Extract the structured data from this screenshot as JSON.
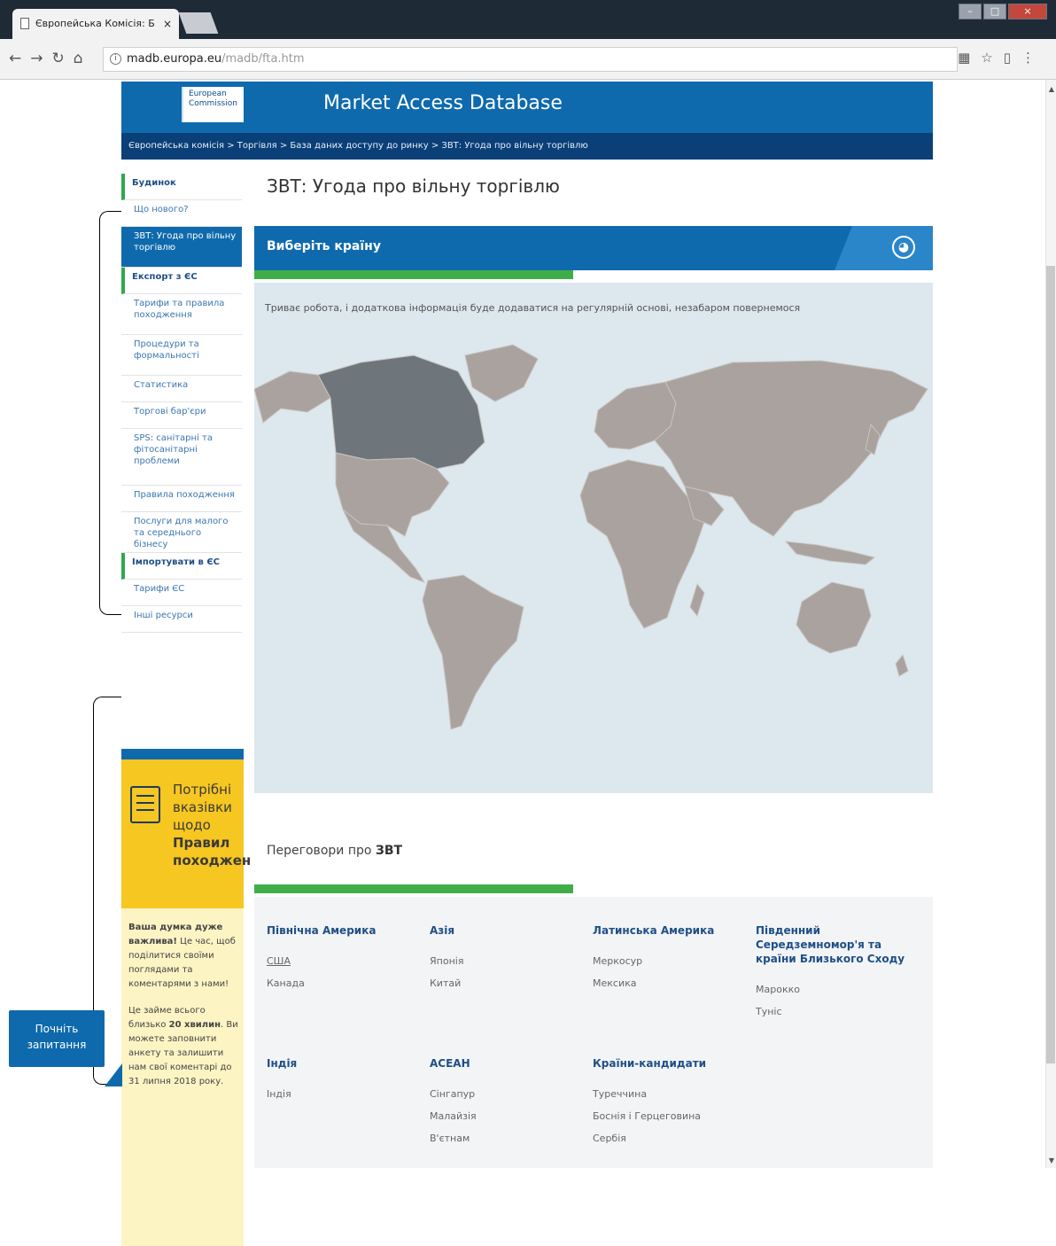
{
  "browser": {
    "tab_title": "Європейська Комісія: Б",
    "tab_close": "×",
    "url_host": "madb.europa.eu",
    "url_path": "/madb/fta.htm"
  },
  "header": {
    "logo_line1": "European",
    "logo_line2": "Commission",
    "site_title": "Market Access Database"
  },
  "breadcrumb": "Європейська комісія > Торгівля > База даних доступу до ринку > ЗВТ: Угода про вільну торгівлю",
  "sidebar": {
    "items": [
      {
        "label": "Будинок",
        "type": "section"
      },
      {
        "label": "Що нового?",
        "type": "link"
      },
      {
        "label": "ЗВТ: Угода про вільну торгівлю",
        "type": "active"
      },
      {
        "label": "Експорт з ЄС",
        "type": "section"
      },
      {
        "label": "Тарифи та правила походження",
        "type": "link"
      },
      {
        "label": "Процедури та формальності",
        "type": "link"
      },
      {
        "label": "Статистика",
        "type": "link"
      },
      {
        "label": "Торгові бар'єри",
        "type": "link"
      },
      {
        "label": "SPS: санітарні та фітосанітарні проблеми",
        "type": "link"
      },
      {
        "label": "Правила походження",
        "type": "link"
      },
      {
        "label": "Послуги для малого та середнього бізнесу",
        "type": "link"
      },
      {
        "label": "Імпортувати в ЄС",
        "type": "section"
      },
      {
        "label": "Тарифи ЄС",
        "type": "link"
      },
      {
        "label": "Інші ресурси",
        "type": "link"
      }
    ]
  },
  "promo": {
    "line1": "Потрібні",
    "line2": "вказівки",
    "line3": "щодо",
    "line4": "Правил",
    "line5": "походжен"
  },
  "feedback": {
    "bold": "Ваша думка дуже важлива!",
    "text1": " Це час, щоб поділитися своїми поглядами та коментарями з нами!",
    "text2": "Це займе всього близько ",
    "bold2": "20 хвилин",
    "text3": ". Ви можете заповнити анкету та залишити нам свої коментарі до 31 липня 2018 року.",
    "button": "Почніть запитання"
  },
  "main": {
    "page_title": "ЗВТ: Угода про вільну торгівлю",
    "select_country": "Виберіть країну",
    "note": "Триває робота, і додаткова інформація буде додаватися на регулярній основі, незабаром повернемося",
    "negotiations_prefix": "Переговори про ",
    "negotiations_bold": "ЗВТ"
  },
  "regions": [
    {
      "title": "Північна Америка",
      "items": [
        "США",
        "Канада"
      ]
    },
    {
      "title": "Азія",
      "items": [
        "Японія",
        "Китай"
      ]
    },
    {
      "title": "Латинська Америка",
      "items": [
        "Меркосур",
        "Мексика"
      ]
    },
    {
      "title": "Південний Середземномор'я та країни Близького Сходу",
      "items": [
        "Марокко",
        "Туніс"
      ]
    },
    {
      "title": "Індія",
      "items": [
        "Індія"
      ]
    },
    {
      "title": "АСЕАН",
      "items": [
        "Сінгапур",
        "Малайзія",
        "В'єтнам"
      ]
    },
    {
      "title": "Країни-кандидати",
      "items": [
        "Туреччина",
        "Боснія і Герцеговина",
        "Сербія"
      ]
    }
  ],
  "colors": {
    "brand_blue": "#0e6aad",
    "dark_blue": "#0a3f78",
    "green_accent": "#3fae49",
    "promo_yellow": "#f6c621",
    "map_land": "#a9a29e",
    "map_highlight": "#6e767b",
    "map_water": "#dce7ee"
  }
}
